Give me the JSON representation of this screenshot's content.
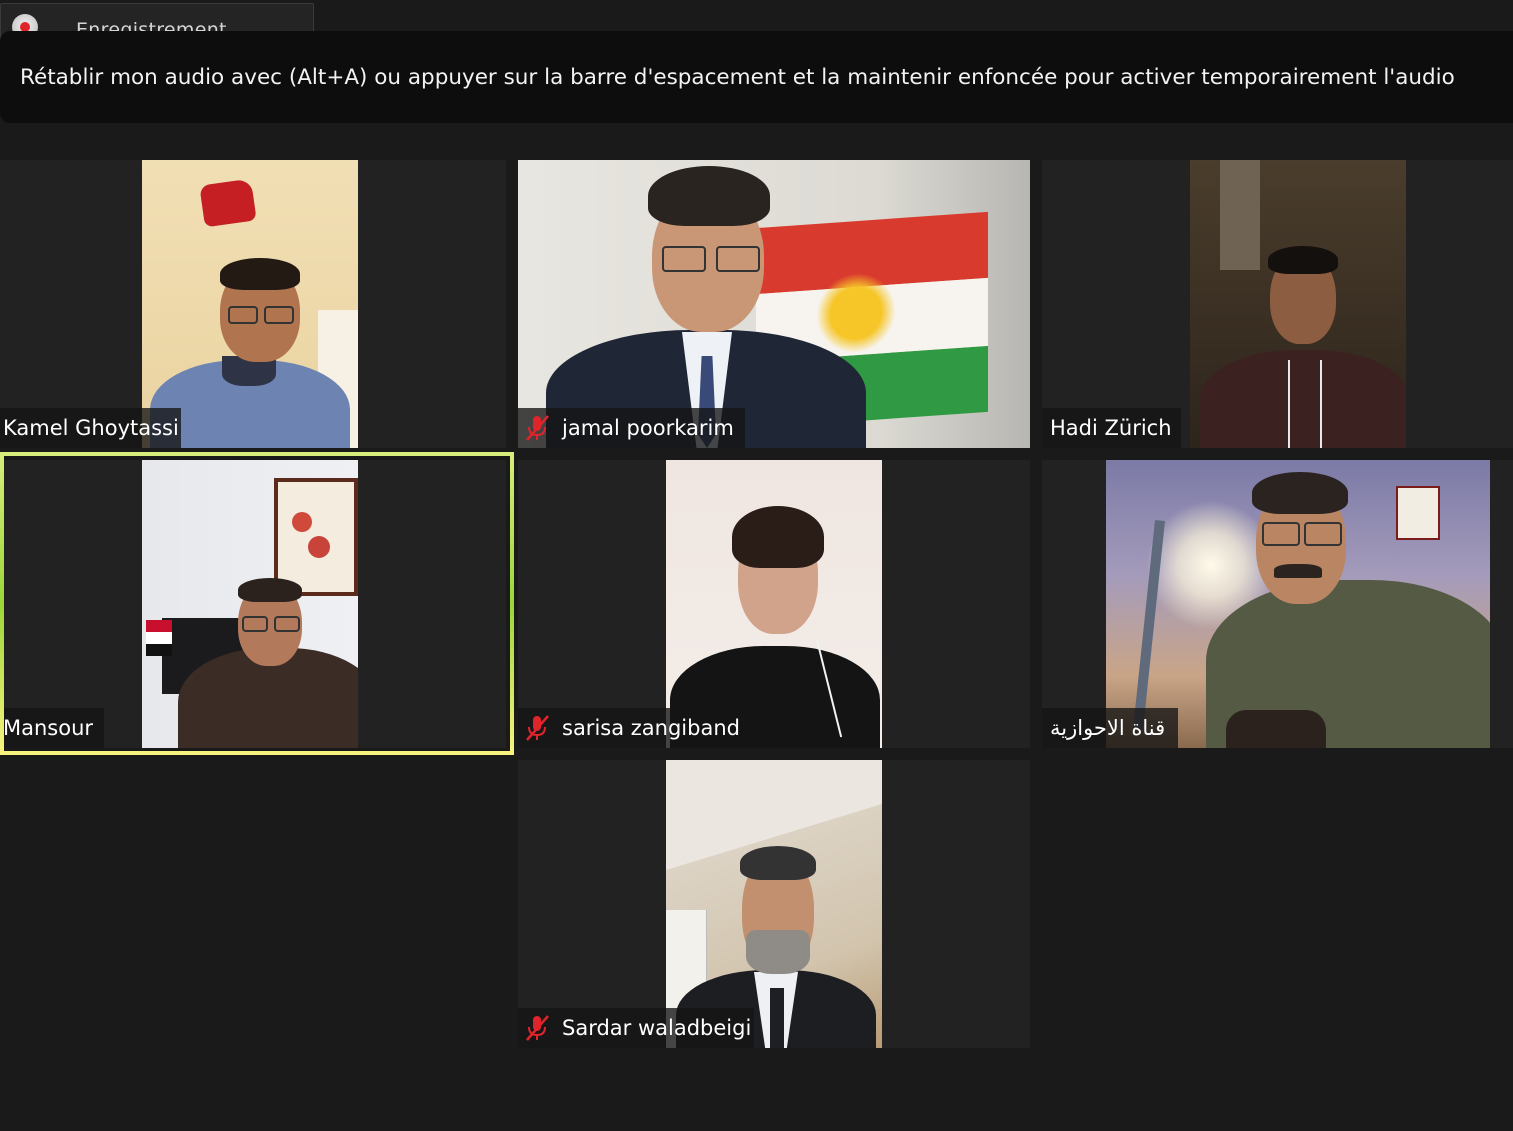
{
  "recording": {
    "label": "Enregistrement..."
  },
  "banner": {
    "text": "Rétablir mon audio avec (Alt+A) ou appuyer sur la barre d'espacement et la maintenir enfoncée pour activer temporairement l'audio"
  },
  "participants": [
    {
      "name": "Kamel Ghoytassi",
      "muted": false
    },
    {
      "name": "jamal poorkarim",
      "muted": true
    },
    {
      "name": "Hadi Zürich",
      "muted": false
    },
    {
      "name": "Mansour",
      "muted": false,
      "active_speaker": true
    },
    {
      "name": "sarisa zangiband",
      "muted": true
    },
    {
      "name": "قناة الاحوازية",
      "muted": false
    },
    {
      "name": "Sardar waladbeigi",
      "muted": true
    }
  ],
  "icons": {
    "recording": "record-icon",
    "muted_mic": "mic-muted-icon"
  },
  "colors": {
    "background": "#1a1a1a",
    "tile": "#222222",
    "banner": "#0d0d0d",
    "muted_red": "#e0242b",
    "active_border": "#c8e860"
  }
}
